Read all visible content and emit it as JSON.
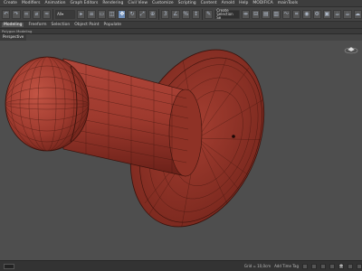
{
  "menus": [
    "Create",
    "Modifiers",
    "Animation",
    "Graph Editors",
    "Rendering",
    "Civil View",
    "Customize",
    "Scripting",
    "Content",
    "Arnold",
    "Help",
    "MODIFICA",
    "mainTools"
  ],
  "toolbar": {
    "filter_dropdown": "All",
    "selection_set": "Create Selection Se"
  },
  "ribbon": {
    "tabs": [
      "Modeling",
      "Freeform",
      "Selection",
      "Object Paint",
      "Populate"
    ],
    "selected_tab": "Modeling"
  },
  "subbar": [
    "Polygon Modeling",
    "",
    ""
  ],
  "viewport": {
    "label": "Perspective"
  },
  "status": {
    "grid": "Grid = 10,0cm",
    "add_time_tag": "Add Time Tag"
  },
  "colors": {
    "model": "#9e3a2e",
    "wire": "#3a120c",
    "background": "#4e4e4e"
  }
}
